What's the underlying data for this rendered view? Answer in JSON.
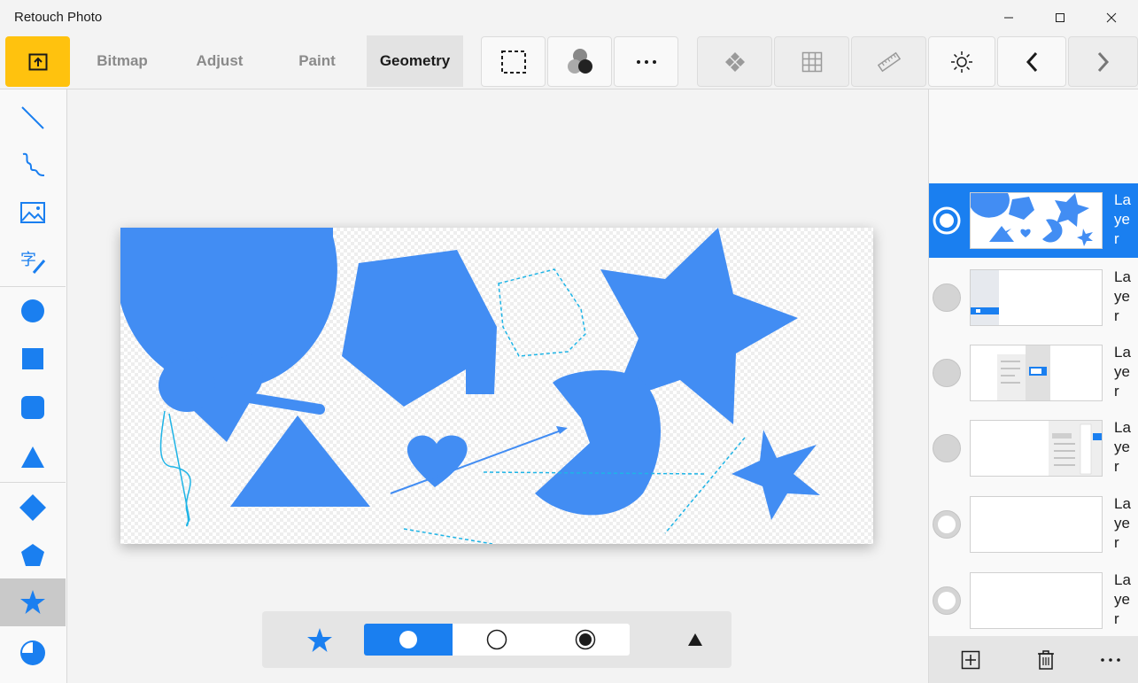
{
  "app": {
    "title": "Retouch Photo"
  },
  "window": {
    "minimize_icon": "minimize-icon",
    "maximize_icon": "maximize-icon",
    "close_icon": "close-icon"
  },
  "toolbar": {
    "export_icon": "export-icon",
    "tabs": [
      {
        "label": "Bitmap",
        "active": false
      },
      {
        "label": "Adjust",
        "active": false
      },
      {
        "label": "Paint",
        "active": false
      },
      {
        "label": "Geometry",
        "active": true
      }
    ],
    "buttons": [
      "selection-icon",
      "blend-icon",
      "more-icon",
      "transform-icon",
      "grid-icon",
      "ruler-icon",
      "brightness-icon",
      "undo-icon",
      "redo-icon"
    ]
  },
  "sidebar": {
    "tools": [
      "line-tool",
      "freehand-tool",
      "image-tool",
      "text-tool",
      "ellipse-tool",
      "rectangle-tool",
      "rounded-rectangle-tool",
      "triangle-tool",
      "diamond-tool",
      "pentagon-tool",
      "star-tool",
      "pie-tool"
    ],
    "selected": "star-tool"
  },
  "options": {
    "shape_icon": "star-icon",
    "fill_modes": [
      "fill-only",
      "stroke-only",
      "fill-and-stroke"
    ],
    "selected_mode": "fill-only",
    "expand_icon": "expand-triangle-icon"
  },
  "layers": {
    "items": [
      {
        "name": "Layer",
        "selected": true
      },
      {
        "name": "Layer",
        "selected": false
      },
      {
        "name": "Layer",
        "selected": false
      },
      {
        "name": "Layer",
        "selected": false
      },
      {
        "name": "Layer",
        "selected": false
      },
      {
        "name": "Layer",
        "selected": false
      }
    ],
    "footer": [
      "add-layer-icon",
      "delete-layer-icon",
      "more-icon"
    ]
  },
  "colors": {
    "accent": "#1a7ff0",
    "shape_fill": "#428df3",
    "stroke_cyan": "#1eb4e6",
    "export_yellow": "#ffc20e"
  }
}
